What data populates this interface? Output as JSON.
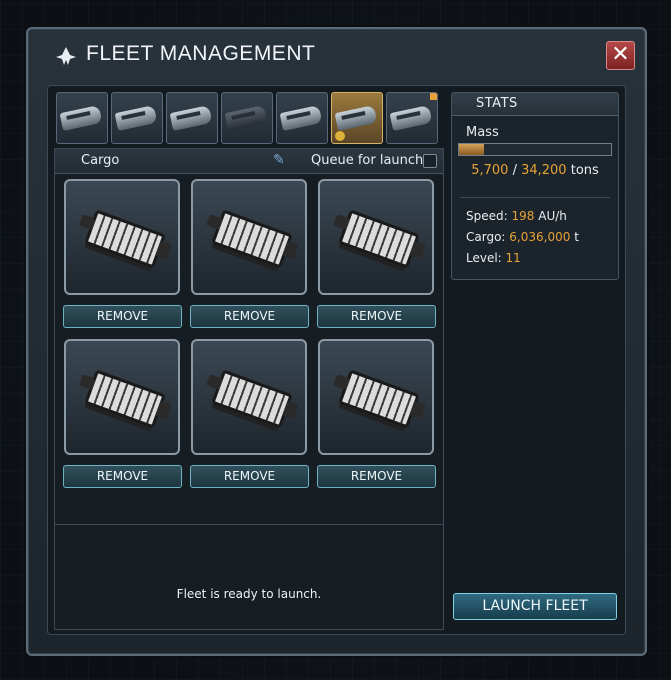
{
  "window": {
    "title": "FLEET MANAGEMENT",
    "close_label": "✕"
  },
  "ship_tabs": [
    {
      "name": "ship-1",
      "active": false
    },
    {
      "name": "ship-2",
      "active": false
    },
    {
      "name": "ship-3",
      "active": false
    },
    {
      "name": "ship-4",
      "active": false
    },
    {
      "name": "ship-5",
      "active": false
    },
    {
      "name": "ship-6",
      "active": true
    },
    {
      "name": "ship-7",
      "active": false
    }
  ],
  "cargo": {
    "title": "Cargo",
    "queue_label": "Queue for launch",
    "remove_label": "REMOVE",
    "slots": 6
  },
  "status": "Fleet is ready to launch.",
  "launch_label": "LAUNCH FLEET",
  "stats": {
    "title": "STATS",
    "mass_label": "Mass",
    "mass_current": "5,700",
    "mass_max": "34,200",
    "mass_unit": "tons",
    "mass_fraction": 0.1667,
    "speed_label": "Speed:",
    "speed_value": "198",
    "speed_unit": "AU/h",
    "cargo_label": "Cargo:",
    "cargo_value": "6,036,000",
    "cargo_unit": "t",
    "level_label": "Level:",
    "level_value": "11"
  },
  "colors": {
    "accent": "#e6a23a",
    "button_border": "#6fb3c4",
    "close": "#a23636"
  },
  "icons": [
    "fleet-icon",
    "close-icon",
    "pencil-icon",
    "cargo-ship-icon"
  ]
}
